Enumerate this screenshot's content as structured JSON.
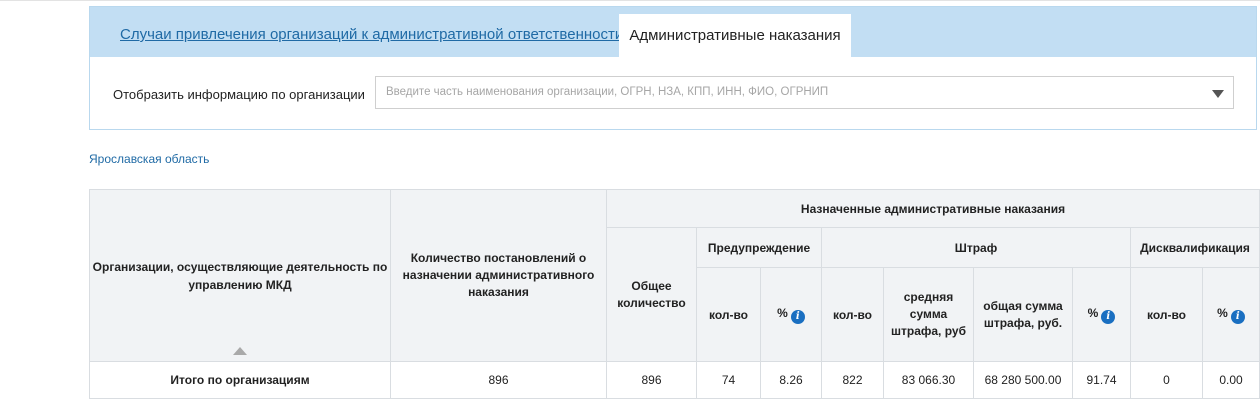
{
  "tabs": {
    "inactive_label": "Случаи привлечения организаций к административной ответственности",
    "active_label": "Административные наказания"
  },
  "filter": {
    "label": "Отобразить информацию по организации",
    "placeholder": "Введите часть наименования организации, ОГРН, НЗА, КПП, ИНН, ФИО, ОГРНИП"
  },
  "region": "Ярославская область",
  "table": {
    "headers": {
      "organizations": "Организации, осуществляющие деятельность по управлению МКД",
      "decisions_count": "Количество постановлений о назначении административного наказания",
      "assigned_group": "Назначенные административные наказания",
      "total_count": "Общее количество",
      "warning_group": "Предупреждение",
      "fine_group": "Штраф",
      "disqualification_group": "Дисквалификация",
      "count": "кол-во",
      "percent": "%",
      "avg_fine": "средняя сумма штрафа, руб",
      "total_fine": "общая сумма штрафа, руб."
    },
    "total_row": {
      "label": "Итого по организациям",
      "decisions_count": "896",
      "total_count": "896",
      "warning_count": "74",
      "warning_percent": "8.26",
      "fine_count": "822",
      "avg_fine": "83 066.30",
      "total_fine": "68 280 500.00",
      "fine_percent": "91.74",
      "disq_count": "0",
      "disq_percent": "0.00"
    }
  },
  "colors": {
    "tab_bar": "#c2def3",
    "link": "#1f6aa5",
    "info_icon": "#1a6fc1",
    "header_bg": "#f1f3f5"
  }
}
